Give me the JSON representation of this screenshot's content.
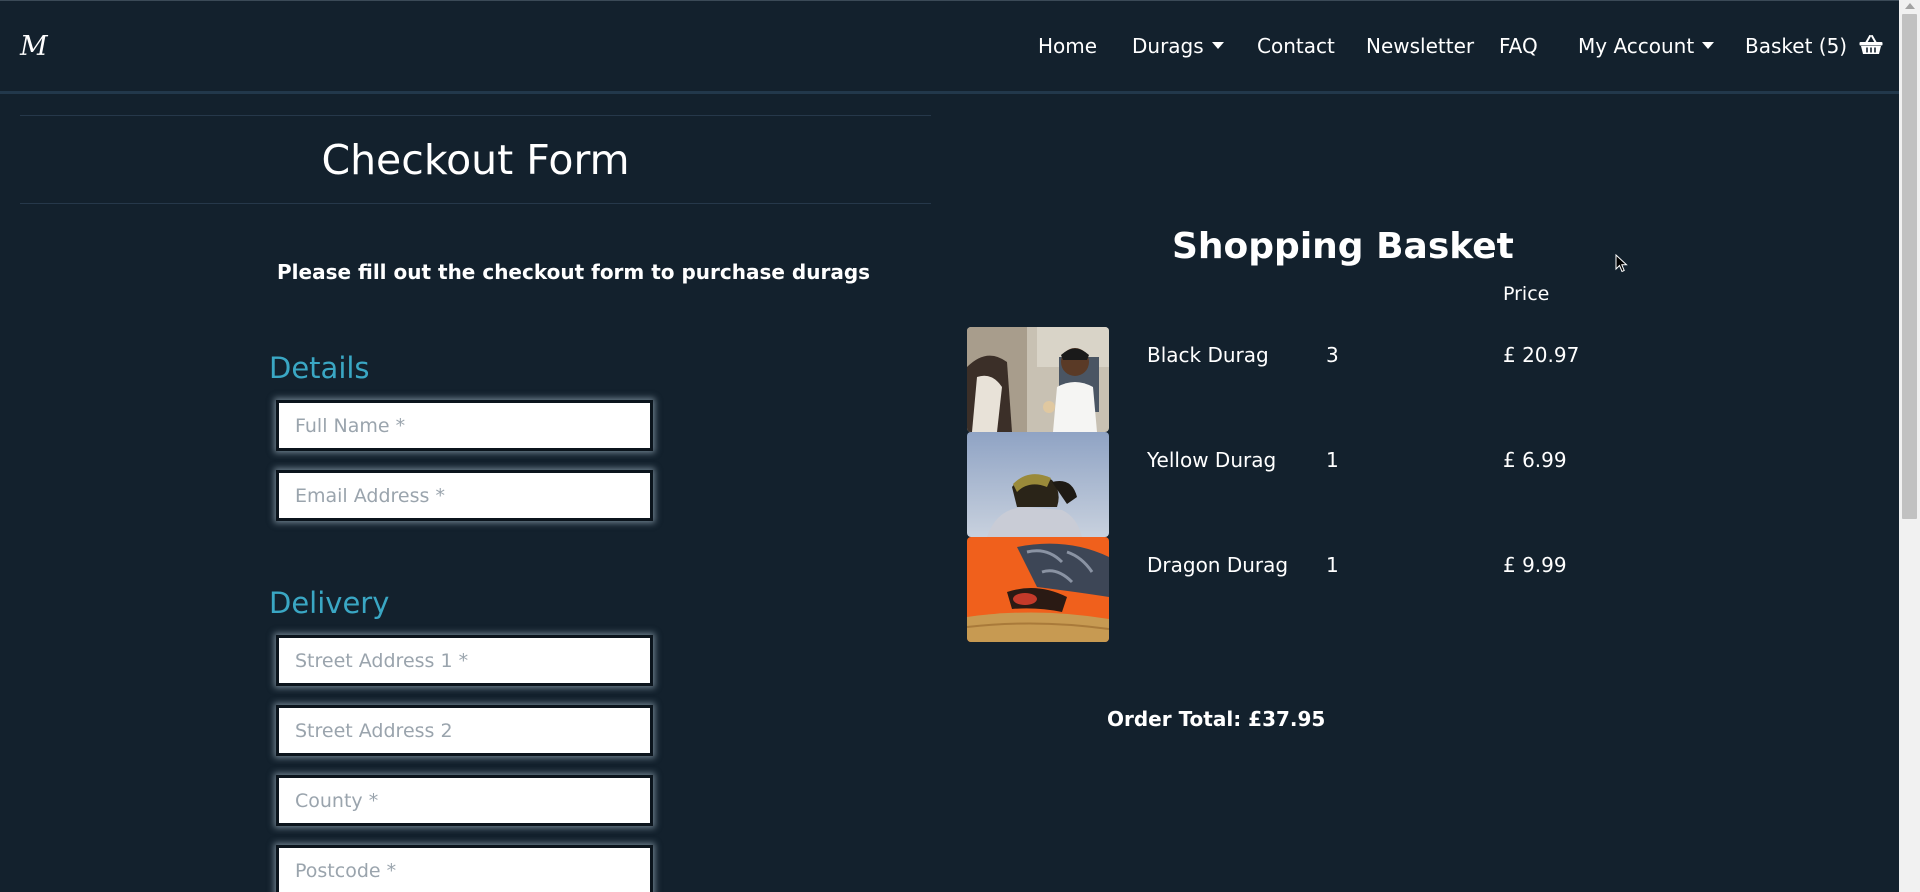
{
  "brand": {
    "logo_text": "M"
  },
  "nav": {
    "home": "Home",
    "durags": "Durags",
    "contact": "Contact",
    "newsletter": "Newsletter",
    "faq": "FAQ",
    "my_account": "My Account",
    "basket": "Basket (5)"
  },
  "checkout": {
    "title": "Checkout Form",
    "instruction": "Please fill out the checkout form to purchase durags",
    "details_heading": "Details",
    "delivery_heading": "Delivery",
    "fields": {
      "full_name": {
        "placeholder": "Full Name *",
        "value": ""
      },
      "email": {
        "placeholder": "Email Address *",
        "value": ""
      },
      "street1": {
        "placeholder": "Street Address 1 *",
        "value": ""
      },
      "street2": {
        "placeholder": "Street Address 2",
        "value": ""
      },
      "county": {
        "placeholder": "County *",
        "value": ""
      },
      "postcode": {
        "placeholder": "Postcode *",
        "value": ""
      }
    }
  },
  "basket": {
    "title": "Shopping Basket",
    "price_header": "Price",
    "items": [
      {
        "name": "Black Durag",
        "qty": "3",
        "price": "£ 20.97",
        "image_icon": "black-durag-photo"
      },
      {
        "name": "Yellow Durag",
        "qty": "1",
        "price": "£ 6.99",
        "image_icon": "yellow-durag-photo"
      },
      {
        "name": "Dragon Durag",
        "qty": "1",
        "price": "£ 9.99",
        "image_icon": "dragon-durag-photo"
      }
    ],
    "order_total": "Order Total: £37.95"
  },
  "colors": {
    "background": "#13212d",
    "accent_heading": "#3aa7c4",
    "text": "#ffffff"
  }
}
